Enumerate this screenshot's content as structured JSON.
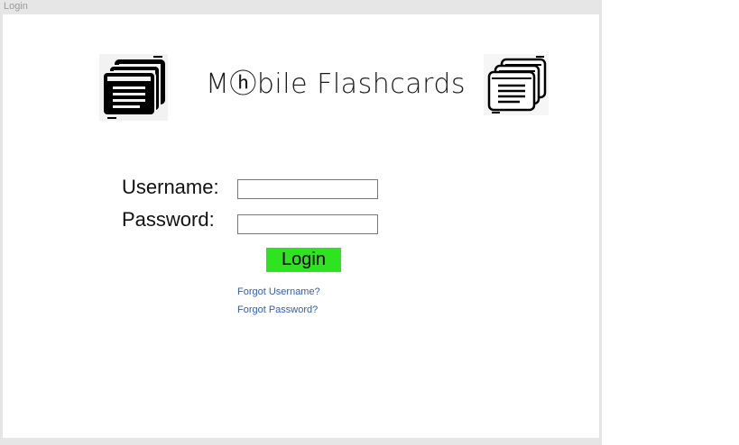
{
  "window": {
    "title": "Login"
  },
  "header": {
    "title": "Mⓗbile Flashcards",
    "left_logo_icon": "flashcards-filled-icon",
    "right_logo_icon": "flashcards-outline-icon"
  },
  "form": {
    "username_label": "Username:",
    "password_label": "Password:",
    "username_value": "",
    "password_value": "",
    "login_label": "Login",
    "forgot_username": "Forgot Username?",
    "forgot_password": "Forgot Password?"
  },
  "colors": {
    "login_button": "#2ee31f",
    "link": "#2f5bc4",
    "window_frame": "#e6e6e6"
  }
}
